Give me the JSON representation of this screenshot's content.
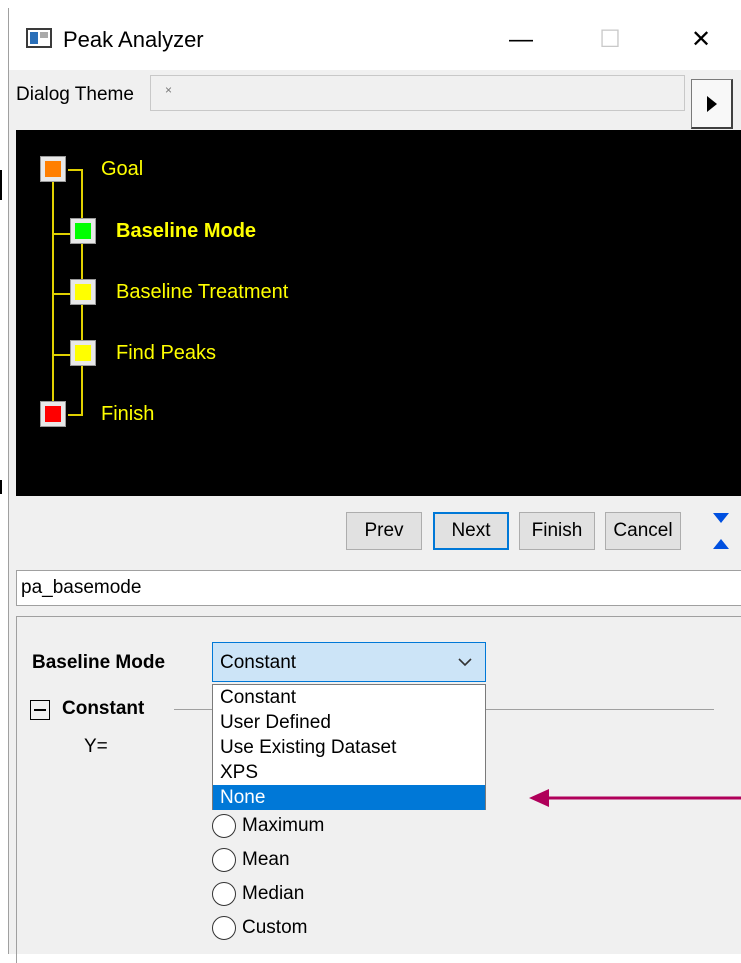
{
  "window": {
    "title": "Peak Analyzer",
    "controls": {
      "minimize": "—",
      "maximize": "☐",
      "close": "✕"
    }
  },
  "theme": {
    "label": "Dialog Theme",
    "value": "×",
    "menu_button_icon": "right-triangle-icon"
  },
  "wizard": {
    "steps": [
      {
        "label": "Goal",
        "color": "#ff7f00",
        "current": false
      },
      {
        "label": "Baseline Mode",
        "color": "#00ff00",
        "current": true
      },
      {
        "label": "Baseline Treatment",
        "color": "#ffff00",
        "current": false
      },
      {
        "label": "Find Peaks",
        "color": "#ffff00",
        "current": false
      },
      {
        "label": "Finish",
        "color": "#ff0000",
        "current": false
      }
    ],
    "label_color": "#ffff00",
    "background": "#000000"
  },
  "navigation": {
    "prev": "Prev",
    "next": "Next",
    "finish": "Finish",
    "cancel": "Cancel",
    "arrow_down_icon": "down-triangle-icon",
    "arrow_up_icon": "up-triangle-icon"
  },
  "page_name": "pa_basemode",
  "settings": {
    "baseline_mode_label": "Baseline Mode",
    "baseline_mode_value": "Constant",
    "dropdown_options": [
      "Constant",
      "User Defined",
      "Use Existing Dataset",
      "XPS",
      "None"
    ],
    "highlighted_option": "None",
    "constant_group": "Constant",
    "collapse_symbol": "−",
    "y_label": "Y=",
    "radio_options": [
      "Maximum",
      "Mean",
      "Median",
      "Custom"
    ]
  },
  "colors": {
    "accent": "#0078d7",
    "annotation_arrow": "#b0005a"
  }
}
